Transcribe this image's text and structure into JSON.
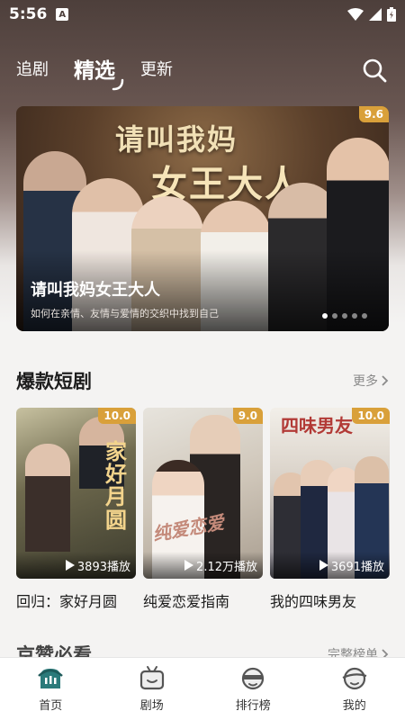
{
  "status": {
    "time": "5:56",
    "notif_letter": "A"
  },
  "colors": {
    "accent": "#2a7a7a",
    "badge": "#d9a03a"
  },
  "top_nav": {
    "tabs": [
      {
        "label": "追剧"
      },
      {
        "label": "精选"
      },
      {
        "label": "更新"
      }
    ],
    "active_tab": "精选",
    "search_icon": "search-icon"
  },
  "banner": {
    "rating": "9.6",
    "art_title_line1": "请叫我妈",
    "art_title_line2": "女王大人",
    "title": "请叫我妈女王大人",
    "description": "如何在亲情、友情与爱情的交织中找到自己",
    "page_count": 5,
    "active_page": 1
  },
  "hot_section": {
    "title": "爆款短剧",
    "more_label": "更多",
    "items": [
      {
        "title": "回归：家好月圆",
        "rating": "10.0",
        "plays": "3893播放",
        "poster_text": "家好月圆"
      },
      {
        "title": "纯爱恋爱指南",
        "rating": "9.0",
        "plays": "2.12万播放",
        "poster_text": "纯爱恋爱"
      },
      {
        "title": "我的四味男友",
        "rating": "10.0",
        "plays": "3691播放",
        "poster_text": "四味男友"
      }
    ]
  },
  "second_section": {
    "title": "京赞必看",
    "more_label": "完整榜单"
  },
  "bottom_nav": {
    "items": [
      {
        "label": "首页",
        "icon": "home-icon"
      },
      {
        "label": "剧场",
        "icon": "tv-icon"
      },
      {
        "label": "排行榜",
        "icon": "ranking-icon"
      },
      {
        "label": "我的",
        "icon": "profile-icon"
      }
    ],
    "active": "首页"
  }
}
